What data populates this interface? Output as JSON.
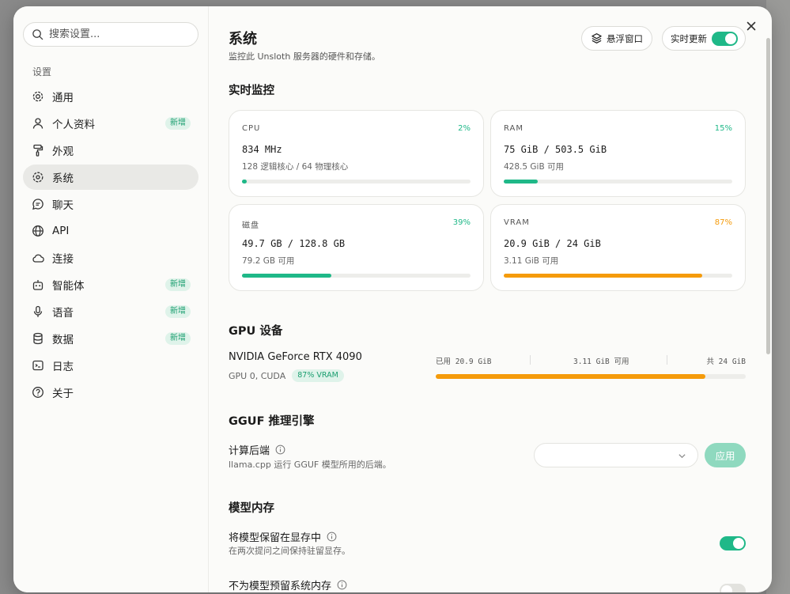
{
  "colors": {
    "accent": "#1fb888",
    "warning": "#f59b0b",
    "badge_bg": "#dff3ea",
    "badge_text": "#1a9e6f"
  },
  "sidebar": {
    "search_placeholder": "搜索设置...",
    "section_label": "设置",
    "items": [
      {
        "label": "通用",
        "icon": "gear-icon",
        "badge": ""
      },
      {
        "label": "个人资料",
        "icon": "user-icon",
        "badge": "新增"
      },
      {
        "label": "外观",
        "icon": "paint-roller-icon",
        "badge": ""
      },
      {
        "label": "系统",
        "icon": "chip-gear-icon",
        "badge": "",
        "active": true
      },
      {
        "label": "聊天",
        "icon": "chat-bubble-icon",
        "badge": ""
      },
      {
        "label": "API",
        "icon": "globe-icon",
        "badge": ""
      },
      {
        "label": "连接",
        "icon": "cloud-icon",
        "badge": ""
      },
      {
        "label": "智能体",
        "icon": "robot-icon",
        "badge": "新增"
      },
      {
        "label": "语音",
        "icon": "microphone-icon",
        "badge": "新增"
      },
      {
        "label": "数据",
        "icon": "database-icon",
        "badge": "新增"
      },
      {
        "label": "日志",
        "icon": "terminal-icon",
        "badge": ""
      },
      {
        "label": "关于",
        "icon": "help-circle-icon",
        "badge": ""
      }
    ]
  },
  "header": {
    "title": "系统",
    "subtitle": "监控此 Unsloth 服务器的硬件和存储。",
    "float_window_label": "悬浮窗口",
    "live_update_label": "实时更新",
    "live_update_on": true
  },
  "monitor": {
    "heading": "实时监控",
    "cards": [
      {
        "label": "CPU",
        "percent": "2%",
        "fraction": 0.02,
        "value": "834 MHz",
        "sub": "128 逻辑核心 / 64 物理核心",
        "color": "#1fb888"
      },
      {
        "label": "RAM",
        "percent": "15%",
        "fraction": 0.15,
        "value": "75 GiB / 503.5 GiB",
        "sub": "428.5 GiB 可用",
        "color": "#1fb888"
      },
      {
        "label": "磁盘",
        "percent": "39%",
        "fraction": 0.39,
        "value": "49.7 GB / 128.8 GB",
        "sub": "79.2 GB 可用",
        "color": "#1fb888"
      },
      {
        "label": "VRAM",
        "percent": "87%",
        "fraction": 0.87,
        "value": "20.9 GiB / 24 GiB",
        "sub": "3.11 GiB 可用",
        "color": "#f59b0b"
      }
    ]
  },
  "gpu": {
    "heading": "GPU 设备",
    "name": "NVIDIA GeForce RTX 4090",
    "meta": "GPU 0, CUDA",
    "badge": "87% VRAM",
    "used_label": "已用 20.9 GiB",
    "free_label": "3.11 GiB 可用",
    "total_label": "共 24 GiB",
    "fraction": 0.87
  },
  "gguf": {
    "heading": "GGUF 推理引擎",
    "backend_title": "计算后端",
    "backend_desc": "llama.cpp 运行 GGUF 模型所用的后端。",
    "select_value": "",
    "apply_label": "应用"
  },
  "memory": {
    "heading": "模型内存",
    "keep_title": "将模型保留在显存中",
    "keep_desc": "在两次提问之间保持驻留显存。",
    "keep_on": true,
    "reserve_title": "不为模型预留系统内存",
    "reserve_on": false
  }
}
